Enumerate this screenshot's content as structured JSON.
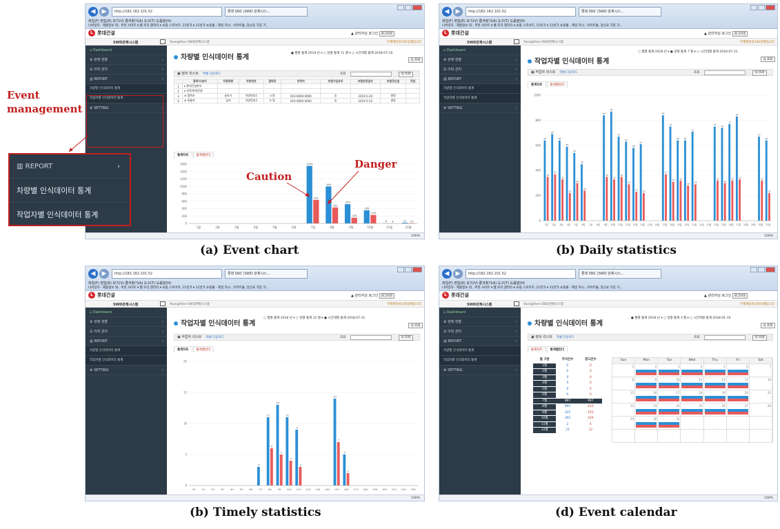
{
  "browser": {
    "address": "http://182.162.101.52",
    "tab_title": "롯데 SNC (SWD 관제시스...",
    "menu": "파일(F)  편집(E)  보기(V)  즐겨찾기(A)  도구(T)  도움말(H)",
    "favorites": "나비일자 · 제품정보 외..   추천 사이트 ▾   웹 조각 갤러리 ▾   쇼핑 스토어즈, 11번가 ▾   11번가 쇼핑몰 - 제일 저시..   이마트몰, 장신요 가장 가..",
    "zoom": "100%"
  },
  "app": {
    "brand": "롯데건설",
    "admin_label": "관리자님 로그인",
    "logout": "로그아웃",
    "system_name": "SWD관제시스템",
    "breadcrumb": "YoungShee  SWD관제시스템",
    "welcome": "무재해달성100일째입니다"
  },
  "sidebar": {
    "dashboard": "Dashboard",
    "control": "관제 현황",
    "event": "이력 관리",
    "report": "REPORT",
    "report_vehicle": "차량별 인식데이터 통계",
    "report_worker": "작업자별 인식데이터 통계",
    "setting": "SETTING"
  },
  "labels": {
    "list": "장비 리스트",
    "worker_list": "작업자 리스트",
    "excel": "엑셀 다운로드",
    "search": "조회",
    "search_btn": "Q 조회",
    "tab_stats": "통계차트",
    "tab_calendar": "통계캘린더"
  },
  "panels": {
    "a": {
      "title": "차량별 인식데이터 통계",
      "filter": "● 월별 통계  2018 년 ▾  ○ 일별 통계  11 월 ▾  ○ 시간대별 통계  2018-07-10",
      "caption": "(a) Event chart"
    },
    "b": {
      "title": "작업자별 인식데이터 통계",
      "filter": "○ 월별 통계  2018 년 ▾  ● 일별 통계  7 월 ▾  ○ 시간대별 통계  2018-07-31",
      "caption": "(b) Daily statistics"
    },
    "c": {
      "title": "작업자별 인식데이터 통계",
      "filter": "○ 월별 통계  2018 년 ▾  ○ 일별 통계  12 월 ▾  ● 시간대별 통계  2018-07-31",
      "caption": "(b) Timely statistics"
    },
    "d": {
      "title": "차량별 인식데이터 통계",
      "filter": "● 월별 통계  2018 년 ▾  ○ 일별 통계  3 월 ▾  ○ 시간대별 통계  2018-01-10",
      "caption": "(d) Event calendar"
    }
  },
  "annotations": {
    "event_management": "Event management",
    "caution": "Caution",
    "danger": "Danger"
  },
  "table_a": {
    "headers": [
      "",
      "협력사/분리",
      "차량종류",
      "차량번호",
      "협력장",
      "연락처",
      "보험가입유무",
      "보험만료일자",
      "보험정산일",
      "작업"
    ],
    "rows": [
      [
        "1",
        "▸ 롯데건설본부",
        "",
        "",
        "",
        "",
        "",
        "",
        "",
        ""
      ],
      [
        "2",
        "  ▸ 외곽/현대건설",
        "",
        "",
        "",
        "",
        "",
        "",
        "",
        ""
      ],
      [
        "3",
        "    ⊕ 협력사",
        "굴삭기",
        "차량번호1",
        "a 명",
        "010-0000-0000",
        "승",
        "2019-5-20",
        "결정",
        ""
      ],
      [
        "4",
        "    ⊕ 화물차",
        "덤프",
        "차량번호2",
        "b 명",
        "010-0000-0000",
        "승",
        "2019-5-22",
        "결정",
        ""
      ]
    ]
  },
  "calendar": {
    "list_headers": [
      "월 구분",
      "주의건수",
      "경고건수"
    ],
    "months": [
      "1월",
      "2월",
      "3월",
      "4월",
      "5월",
      "6월",
      "7월",
      "8월",
      "9월",
      "10월",
      "11월",
      "12월"
    ],
    "caution": [
      "0",
      "0",
      "0",
      "0",
      "0",
      "0",
      "997",
      "995",
      "325",
      "395",
      "2",
      "21"
    ],
    "warning": [
      "0",
      "0",
      "0",
      "0",
      "0",
      "0",
      "997",
      "432",
      "155",
      "329",
      "4",
      "12"
    ],
    "weekdays": [
      "Sun",
      "Mon",
      "Tue",
      "Wed",
      "Thu",
      "Fri",
      "Sat"
    ]
  },
  "chart_data": [
    {
      "type": "bar",
      "categories": [
        "1월",
        "2월",
        "3월",
        "4월",
        "5월",
        "6월",
        "7월",
        "8월",
        "9월",
        "10월",
        "11월",
        "12월"
      ],
      "series": [
        {
          "values": [
            0,
            0,
            0,
            0,
            0,
            0,
            1553,
            999,
            520,
            355,
            6,
            21
          ]
        },
        {
          "values": [
            0,
            0,
            0,
            0,
            0,
            0,
            637,
            432,
            155,
            229,
            4,
            12
          ]
        }
      ],
      "yticks": [
        "0",
        "200",
        "400",
        "600",
        "800",
        "1000",
        "1200",
        "1400",
        "1600"
      ],
      "ylim": [
        0,
        1600
      ],
      "colors": [
        "#2b8fd6",
        "#e85a5a"
      ]
    },
    {
      "type": "bar",
      "categories": [
        "1일",
        "2일",
        "3일",
        "4일",
        "5일",
        "6일",
        "7일",
        "8일",
        "9일",
        "10일",
        "11일",
        "12일",
        "13일",
        "14일",
        "15일",
        "16일",
        "17일",
        "18일",
        "19일",
        "20일",
        "21일",
        "22일",
        "23일",
        "24일",
        "25일",
        "26일",
        "27일",
        "28일",
        "29일",
        "30일",
        "31일"
      ],
      "series": [
        {
          "values": [
            64,
            69,
            64,
            59,
            54,
            45,
            0,
            0,
            84,
            87,
            67,
            63,
            58,
            61,
            0,
            0,
            84,
            75,
            64,
            64,
            71,
            0,
            0,
            75,
            74,
            77,
            83,
            0,
            0,
            67,
            64
          ]
        },
        {
          "values": [
            35,
            37,
            33,
            22,
            30,
            24,
            0,
            0,
            35,
            33,
            35,
            29,
            23,
            22,
            0,
            0,
            37,
            31,
            32,
            28,
            29,
            0,
            0,
            32,
            30,
            32,
            33,
            0,
            0,
            32,
            22
          ]
        }
      ],
      "yticks": [
        "0",
        "200",
        "400",
        "600",
        "800",
        "1000"
      ],
      "ylim": [
        0,
        100
      ],
      "colors": [
        "#2b8fd6",
        "#e85a5a"
      ]
    },
    {
      "type": "bar",
      "categories": [
        "0H",
        "1H",
        "2H",
        "3H",
        "4H",
        "5H",
        "6H",
        "7H",
        "8H",
        "9H",
        "10H",
        "11H",
        "12H",
        "13H",
        "14H",
        "15H",
        "16H",
        "17H",
        "18H",
        "19H",
        "20H",
        "21H",
        "22H",
        "23H"
      ],
      "series": [
        {
          "values": [
            0,
            0,
            0,
            0,
            0,
            0,
            0,
            3,
            11,
            13,
            11,
            9,
            0,
            0,
            0,
            14,
            5,
            0,
            0,
            0,
            0,
            0,
            0,
            0
          ]
        },
        {
          "values": [
            0,
            0,
            0,
            0,
            0,
            0,
            0,
            0,
            6,
            5,
            4,
            3,
            0,
            0,
            0,
            7,
            2,
            0,
            0,
            0,
            0,
            0,
            0,
            0
          ]
        }
      ],
      "yticks": [
        "0",
        "5",
        "10",
        "15",
        "20"
      ],
      "ylim": [
        0,
        20
      ],
      "colors": [
        "#2b8fd6",
        "#e85a5a"
      ]
    }
  ]
}
